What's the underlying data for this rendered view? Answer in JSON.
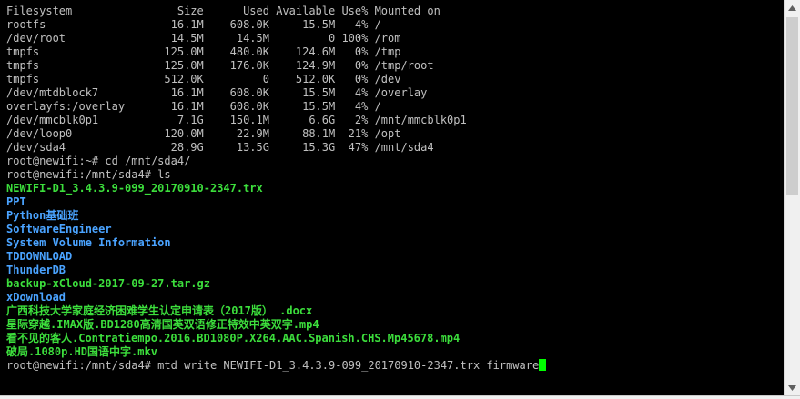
{
  "terminal": {
    "lines": [
      {
        "text": "Filesystem                Size      Used Available Use% Mounted on",
        "type": "output"
      },
      {
        "text": "rootfs                   16.1M    608.0K     15.5M   4% /",
        "type": "output"
      },
      {
        "text": "/dev/root                14.5M     14.5M         0 100% /rom",
        "type": "output"
      },
      {
        "text": "tmpfs                   125.0M    480.0K    124.6M   0% /tmp",
        "type": "output"
      },
      {
        "text": "tmpfs                   125.0M    176.0K    124.9M   0% /tmp/root",
        "type": "output"
      },
      {
        "text": "tmpfs                   512.0K         0    512.0K   0% /dev",
        "type": "output"
      },
      {
        "text": "/dev/mtdblock7           16.1M    608.0K     15.5M   4% /overlay",
        "type": "output"
      },
      {
        "text": "overlayfs:/overlay       16.1M    608.0K     15.5M   4% /",
        "type": "output"
      },
      {
        "text": "/dev/mmcblk0p1            7.1G    150.1M      6.6G   2% /mnt/mmcblk0p1",
        "type": "output"
      },
      {
        "text": "/dev/loop0              120.0M     22.9M     88.1M  21% /opt",
        "type": "output"
      },
      {
        "text": "/dev/sda4                28.9G     13.5G     15.3G  47% /mnt/sda4",
        "type": "output"
      },
      {
        "text": "root@newifi:~# cd /mnt/sda4/",
        "type": "prompt"
      },
      {
        "text": "root@newifi:/mnt/sda4# ls",
        "type": "prompt"
      },
      {
        "text": "NEWIFI-D1_3.4.3.9-099_20170910-2347.trx",
        "type": "file"
      },
      {
        "text": "PPT",
        "type": "dir"
      },
      {
        "text": "Python基础班",
        "type": "dir"
      },
      {
        "text": "SoftwareEngineer",
        "type": "dir"
      },
      {
        "text": "System Volume Information",
        "type": "dir"
      },
      {
        "text": "TDDOWNLOAD",
        "type": "dir"
      },
      {
        "text": "ThunderDB",
        "type": "dir"
      },
      {
        "text": "backup-xCloud-2017-09-27.tar.gz",
        "type": "file"
      },
      {
        "text": "xDownload",
        "type": "dir"
      },
      {
        "text": "广西科技大学家庭经济困难学生认定申请表（2017版） .docx",
        "type": "file"
      },
      {
        "text": "星际穿越.IMAX版.BD1280高清国英双语修正特效中英双字.mp4",
        "type": "file"
      },
      {
        "text": "看不见的客人.Contratiempo.2016.BD1080P.X264.AAC.Spanish.CHS.Mp45678.mp4",
        "type": "file"
      },
      {
        "text": "破局.1080p.HD国语中字.mkv",
        "type": "file"
      }
    ],
    "current_command": "root@newifi:/mnt/sda4# mtd write NEWIFI-D1_3.4.3.9-099_20170910-2347.trx firmware"
  },
  "scrollbar": {
    "position_fraction": 0.0,
    "visible_fraction": 0.49
  },
  "colors": {
    "background": "#000000",
    "output_text": "#c0c0c0",
    "directory": "#4aa3ff",
    "regular_file": "#3cde3c",
    "cursor": "#00ff00"
  },
  "icons": {
    "scroll_up": "triangle-up-icon",
    "scroll_down": "triangle-down-icon"
  }
}
